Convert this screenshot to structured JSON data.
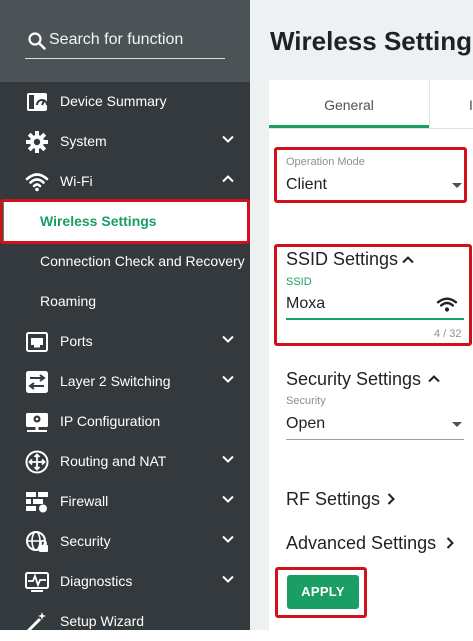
{
  "sidebar": {
    "search_placeholder": "Search for function",
    "items": {
      "device_summary": "Device Summary",
      "system": "System",
      "wifi": "Wi-Fi",
      "wireless_settings": "Wireless Settings",
      "connection_check": "Connection Check and Recovery",
      "roaming": "Roaming",
      "ports": "Ports",
      "layer2": "Layer 2 Switching",
      "ip_config": "IP Configuration",
      "routing_nat": "Routing and NAT",
      "firewall": "Firewall",
      "security": "Security",
      "diagnostics": "Diagnostics",
      "setup_wizard": "Setup Wizard"
    }
  },
  "main": {
    "title": "Wireless Settings",
    "tabs": {
      "general": "General",
      "next": "I"
    },
    "operation_mode": {
      "label": "Operation Mode",
      "value": "Client"
    },
    "ssid_section": {
      "heading": "SSID Settings",
      "label": "SSID",
      "value": "Moxa",
      "counter": "4 / 32"
    },
    "security_section": {
      "heading": "Security Settings",
      "label": "Security",
      "value": "Open"
    },
    "rf_settings": "RF Settings",
    "advanced_settings": "Advanced Settings",
    "apply": "APPLY"
  },
  "colors": {
    "accent": "#1a9e63",
    "highlight": "#d0111b",
    "sidebar_bg": "#33393c"
  }
}
